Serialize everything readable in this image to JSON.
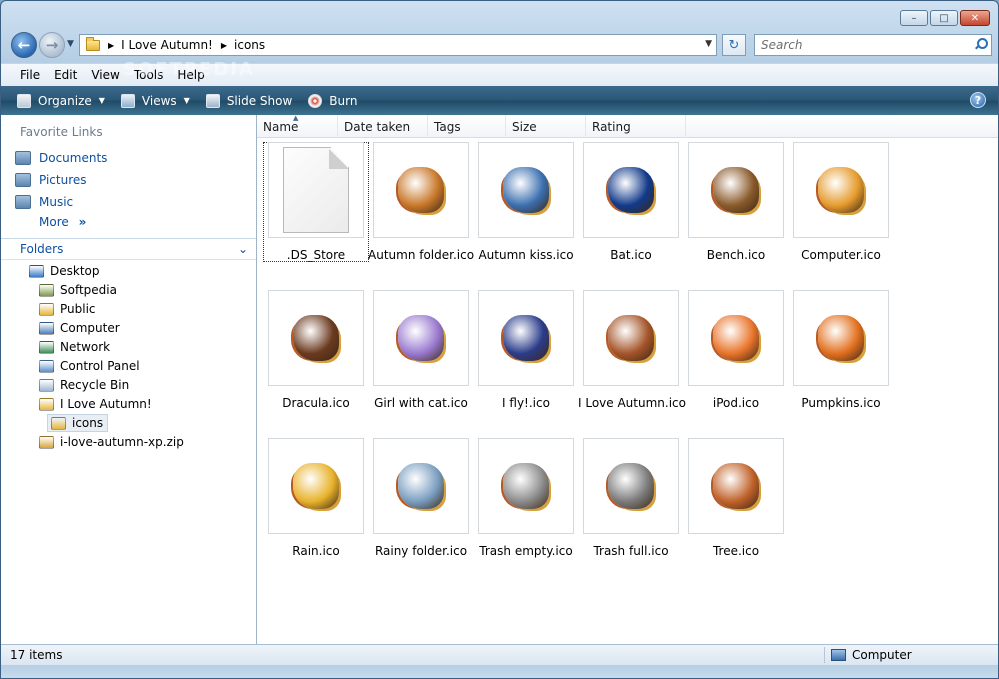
{
  "window": {
    "controls": [
      "minimize",
      "maximize",
      "close"
    ]
  },
  "address": {
    "crumbs": [
      "I Love Autumn!",
      "icons"
    ]
  },
  "search": {
    "placeholder": "Search"
  },
  "watermark": "SOFTPEDIA",
  "menu": [
    "File",
    "Edit",
    "View",
    "Tools",
    "Help"
  ],
  "commands": {
    "organize": "Organize",
    "views": "Views",
    "slideshow": "Slide Show",
    "burn": "Burn"
  },
  "favorites": {
    "title": "Favorite Links",
    "items": [
      "Documents",
      "Pictures",
      "Music"
    ],
    "more": "More"
  },
  "folders": {
    "title": "Folders",
    "tree": [
      {
        "label": "Desktop",
        "icon": "desktop-icon",
        "color": "#3a7bc8"
      },
      {
        "label": "Softpedia",
        "icon": "user-folder-icon",
        "color": "#7d9b4a"
      },
      {
        "label": "Public",
        "icon": "folder-icon",
        "color": "#e6b73e"
      },
      {
        "label": "Computer",
        "icon": "computer-icon",
        "color": "#4a7fb8"
      },
      {
        "label": "Network",
        "icon": "network-icon",
        "color": "#3f8d5a"
      },
      {
        "label": "Control Panel",
        "icon": "control-panel-icon",
        "color": "#5a8fd0"
      },
      {
        "label": "Recycle Bin",
        "icon": "recycle-bin-icon",
        "color": "#9db7d1"
      },
      {
        "label": "I Love Autumn!",
        "icon": "folder-icon",
        "color": "#e6b73e"
      },
      {
        "label": "icons",
        "icon": "folder-icon",
        "color": "#e6b73e"
      },
      {
        "label": "i-love-autumn-xp.zip",
        "icon": "zip-folder-icon",
        "color": "#d9a53a"
      }
    ]
  },
  "columns": [
    "Name",
    "Date taken",
    "Tags",
    "Size",
    "Rating"
  ],
  "files": [
    {
      "name": ".DS_Store",
      "icon": "blank-document-icon",
      "color": "#eeeeee"
    },
    {
      "name": "Autumn folder.ico",
      "icon": "autumn-folder-icon",
      "color": "#c8782a"
    },
    {
      "name": "Autumn kiss.ico",
      "icon": "autumn-kiss-icon",
      "color": "#3b6fb0"
    },
    {
      "name": "Bat.ico",
      "icon": "bat-icon",
      "color": "#123a8a"
    },
    {
      "name": "Bench.ico",
      "icon": "bench-icon",
      "color": "#8a5a2b"
    },
    {
      "name": "Computer.ico",
      "icon": "computer-autumn-icon",
      "color": "#e59b2d"
    },
    {
      "name": "Dracula.ico",
      "icon": "dracula-icon",
      "color": "#6b3a1f"
    },
    {
      "name": "Girl with cat.ico",
      "icon": "girl-with-cat-icon",
      "color": "#9a7ad0"
    },
    {
      "name": "I fly!.ico",
      "icon": "i-fly-icon",
      "color": "#2b3c8a"
    },
    {
      "name": "I Love Autumn.ico",
      "icon": "i-love-autumn-icon",
      "color": "#a5552a"
    },
    {
      "name": "iPod.ico",
      "icon": "ipod-icon",
      "color": "#e8742b"
    },
    {
      "name": "Pumpkins.ico",
      "icon": "pumpkins-icon",
      "color": "#e2701f"
    },
    {
      "name": "Rain.ico",
      "icon": "rain-icon",
      "color": "#e8b22b"
    },
    {
      "name": "Rainy folder.ico",
      "icon": "rainy-folder-icon",
      "color": "#7a9ec0"
    },
    {
      "name": "Trash empty.ico",
      "icon": "trash-empty-icon",
      "color": "#8c8c8c"
    },
    {
      "name": "Trash full.ico",
      "icon": "trash-full-icon",
      "color": "#7b7b7b"
    },
    {
      "name": "Tree.ico",
      "icon": "tree-icon",
      "color": "#c0622a"
    }
  ],
  "status": {
    "count": "17 items",
    "location": "Computer"
  }
}
